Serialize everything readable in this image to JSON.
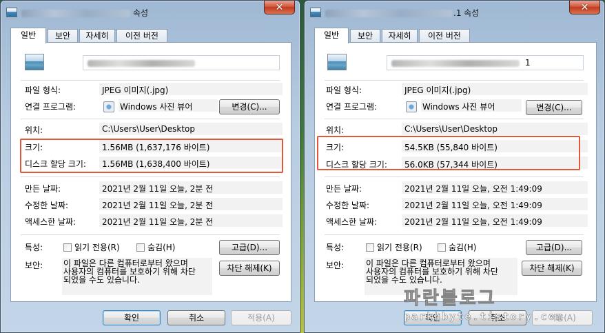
{
  "left": {
    "title_suffix": "속성",
    "tabs": [
      "일반",
      "보안",
      "자세히",
      "이전 버전"
    ],
    "rows": {
      "type_label": "파일 형식:",
      "type_value": "JPEG 이미지(.jpg)",
      "program_label": "연결 프로그램:",
      "program_value": "Windows 사진 뷰어",
      "change_button": "변경(C)...",
      "location_label": "위치:",
      "location_value": "C:\\Users\\User\\Desktop",
      "size_label": "크기:",
      "size_value": "1.56MB (1,637,176 바이트)",
      "disk_label": "디스크 할당 크기:",
      "disk_value": "1.56MB (1,638,400 바이트)",
      "created_label": "만든 날짜:",
      "created_value": "2021년 2월 11일 오늘, 2분 전",
      "modified_label": "수정한 날짜:",
      "modified_value": "2021년 2월 11일 오늘, 2분 전",
      "accessed_label": "액세스한 날짜:",
      "accessed_value": "2021년 2월 11일 오늘, 2분 전",
      "attr_label": "특성:",
      "readonly_label": "읽기 전용(R)",
      "hidden_label": "숨김(H)",
      "advanced_button": "고급(D)...",
      "security_label": "보안:",
      "security_text_1": "이 파일은 다른 컴퓨터로부터 왔으며",
      "security_text_2": "사용자의 컴퓨터를 보호하기 위해 차단",
      "security_text_3": "되었을 수도 있습니다.",
      "unblock_button": "차단 해제(K)"
    },
    "buttons": {
      "ok": "확인",
      "cancel": "취소",
      "apply": "적용(A)"
    }
  },
  "right": {
    "title_suffix": ".1 속성",
    "name_suffix": "1",
    "tabs": [
      "일반",
      "보안",
      "자세히",
      "이전 버전"
    ],
    "rows": {
      "type_label": "파일 형식:",
      "type_value": "JPEG 이미지(.jpg)",
      "program_label": "연결 프로그램:",
      "program_value": "Windows 사진 뷰어",
      "change_button": "변경(C)...",
      "location_label": "위치:",
      "location_value": "C:\\Users\\User\\Desktop",
      "size_label": "크기:",
      "size_value": "54.5KB (55,840 바이트)",
      "disk_label": "디스크 할당 크기:",
      "disk_value": "56.0KB (57,344 바이트)",
      "created_label": "만든 날짜:",
      "created_value": "2021년 2월 11일 오늘, 오전 1:49:09",
      "modified_label": "수정한 날짜:",
      "modified_value": "2021년 2월 11일 오늘, 오전 1:49:09",
      "accessed_label": "액세스한 날짜:",
      "accessed_value": "2021년 2월 11일 오늘, 오전 1:49:09",
      "attr_label": "특성:",
      "readonly_label": "읽기 전용(R)",
      "hidden_label": "숨김(H)",
      "advanced_button": "고급(D)...",
      "security_label": "보안:",
      "security_text_1": "이 파일은 다른 컴퓨터로부터 왔으며",
      "security_text_2": "사용자의 컴퓨터를 보호하기 위해 차단",
      "security_text_3": "되었을 수도 있습니다.",
      "unblock_button": "차단 해제(K)"
    },
    "buttons": {
      "ok": "확인",
      "cancel": "취소",
      "apply": "적용(A)"
    }
  },
  "watermark": {
    "title": "파란블로그",
    "url": "parkhbyte.tistory.com"
  },
  "colors": {
    "highlight": "#e0583a",
    "panel": "#ffffff"
  }
}
